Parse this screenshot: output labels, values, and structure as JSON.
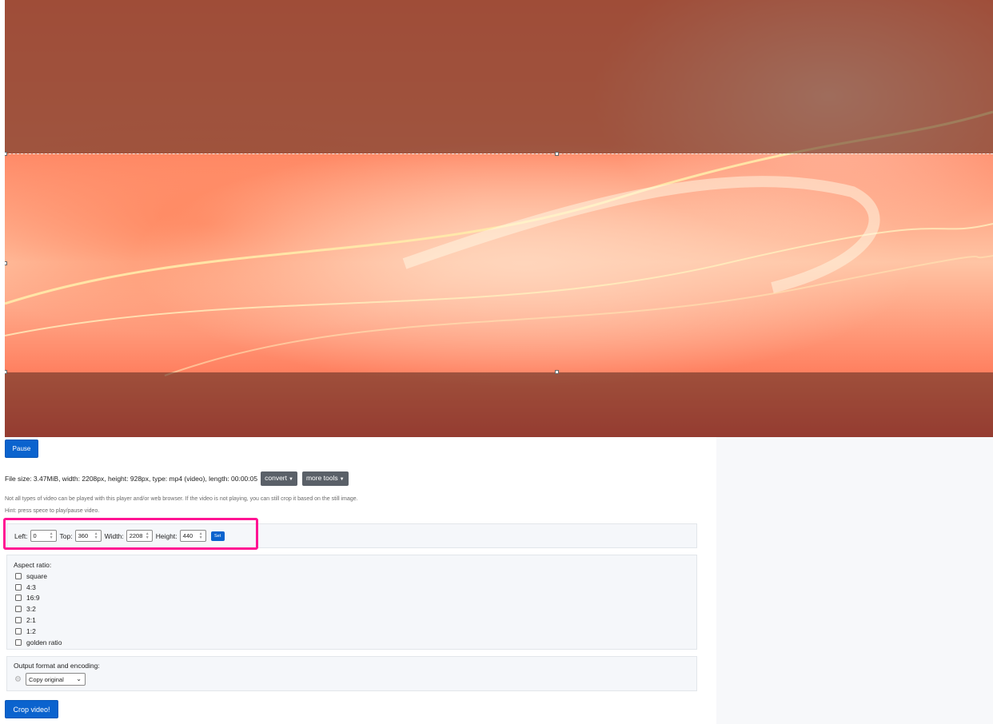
{
  "video": {
    "pause_label": "Pause"
  },
  "file_info": {
    "text": "File size: 3.47MiB, width: 2208px, height: 928px, type: mp4 (video), length: 00:00:05",
    "convert_label": "convert",
    "more_tools_label": "more tools"
  },
  "notes": {
    "compat": "Not all types of video can be played with this player and/or web browser. If the video is not playing, you can still crop it based on the still image.",
    "hint": "Hint: press spece to play/pause video."
  },
  "position": {
    "left_label": "Left:",
    "left_value": "0",
    "top_label": "Top:",
    "top_value": "360",
    "width_label": "Width:",
    "width_value": "2208",
    "height_label": "Height:",
    "height_value": "440",
    "set_label": "Set"
  },
  "aspect": {
    "title": "Aspect ratio:",
    "options": [
      "square",
      "4:3",
      "16:9",
      "3:2",
      "2:1",
      "1:2",
      "golden ratio"
    ]
  },
  "output": {
    "title": "Output format and encoding:",
    "selected": "Copy original",
    "icon": "gear-icon"
  },
  "crop_label": "Crop video!",
  "colors": {
    "primary": "#0b63ce",
    "highlight": "#ff1493",
    "dropdown": "#5a6068"
  }
}
